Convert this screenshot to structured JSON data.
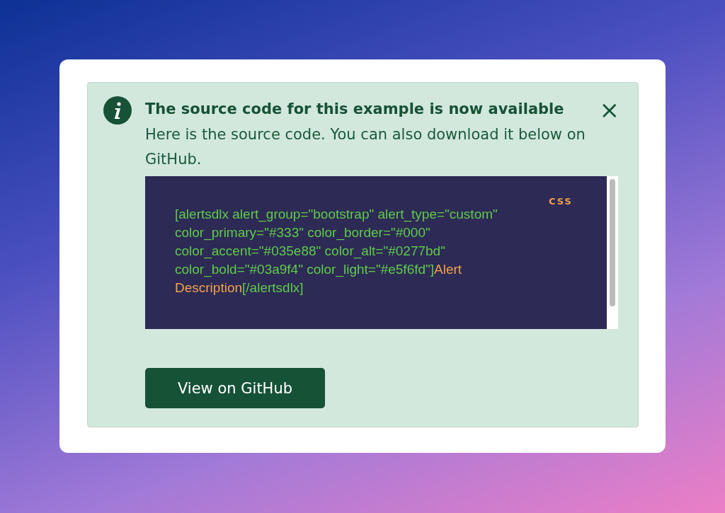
{
  "alert": {
    "title": "The source code for this example is now available",
    "close": "×",
    "message": "Here is the source code. You can also download it below on GitHub.",
    "code": {
      "language": "CSS",
      "segments": [
        {
          "kind": "markup",
          "text": "[alertsdlx alert_group=\"bootstrap\" alert_type=\"custom\" color_primary=\"#333\" color_border=\"#000\" color_accent=\"#035e88\" color_alt=\"#0277bd\" color_bold=\"#03a9f4\" color_light=\"#e5f6fd\"]"
        },
        {
          "kind": "content",
          "text": "Alert Description"
        },
        {
          "kind": "markup",
          "text": "[/alertsdlx]"
        }
      ]
    },
    "button": "View on GitHub"
  }
}
